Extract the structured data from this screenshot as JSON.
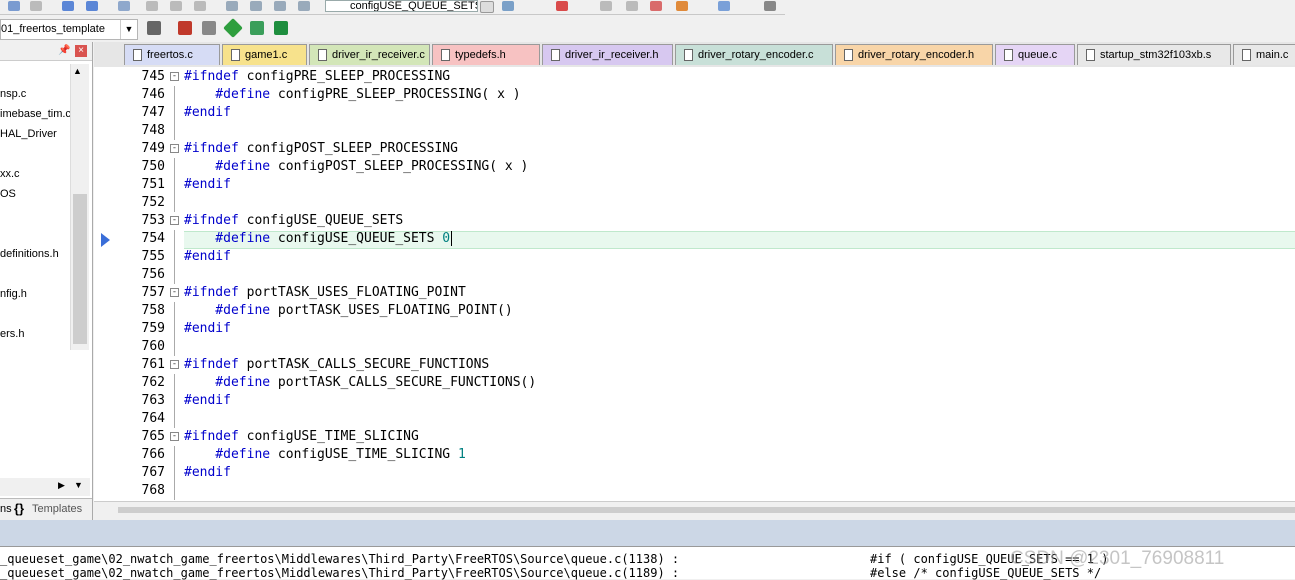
{
  "toolbar": {
    "target_combo": "configUSE_QUEUE_SETS",
    "project_combo": "01_freertos_template"
  },
  "project_tree": {
    "items": [
      "nsp.c",
      "imebase_tim.c",
      "HAL_Driver",
      "xx.c",
      "OS",
      "definitions.h",
      "nfig.h",
      "ers.h"
    ],
    "tabs": [
      "ns",
      "Templates"
    ]
  },
  "editor_tabs": [
    {
      "label": "freertos.c",
      "color": "#d6dcf5"
    },
    {
      "label": "game1.c",
      "color": "#f7e28c"
    },
    {
      "label": "driver_ir_receiver.c",
      "color": "#d3e6b8"
    },
    {
      "label": "typedefs.h",
      "color": "#f7c2c2"
    },
    {
      "label": "driver_ir_receiver.h",
      "color": "#d7c8f0"
    },
    {
      "label": "driver_rotary_encoder.c",
      "color": "#c8e0d8"
    },
    {
      "label": "driver_rotary_encoder.h",
      "color": "#f8d5a8"
    },
    {
      "label": "queue.c",
      "color": "#e5d5f5"
    },
    {
      "label": "startup_stm32f103xb.s",
      "color": "#e8e8e8"
    },
    {
      "label": "main.c",
      "color": "#e8e8e8"
    }
  ],
  "code_lines": [
    {
      "n": "745",
      "fold": "-",
      "directive": "#ifndef",
      "rest": " configPRE_SLEEP_PROCESSING",
      "value": ""
    },
    {
      "n": "746",
      "fold": "",
      "directive": "    #define",
      "rest": " configPRE_SLEEP_PROCESSING( x )",
      "value": ""
    },
    {
      "n": "747",
      "fold": "",
      "directive": "#endif",
      "rest": "",
      "value": ""
    },
    {
      "n": "748",
      "fold": "",
      "directive": "",
      "rest": "",
      "value": ""
    },
    {
      "n": "749",
      "fold": "-",
      "directive": "#ifndef",
      "rest": " configPOST_SLEEP_PROCESSING",
      "value": ""
    },
    {
      "n": "750",
      "fold": "",
      "directive": "    #define",
      "rest": " configPOST_SLEEP_PROCESSING( x )",
      "value": ""
    },
    {
      "n": "751",
      "fold": "",
      "directive": "#endif",
      "rest": "",
      "value": ""
    },
    {
      "n": "752",
      "fold": "",
      "directive": "",
      "rest": "",
      "value": ""
    },
    {
      "n": "753",
      "fold": "-",
      "directive": "#ifndef",
      "rest": " configUSE_QUEUE_SETS",
      "value": ""
    },
    {
      "n": "754",
      "fold": "",
      "directive": "    #define",
      "rest": " configUSE_QUEUE_SETS ",
      "value": "0"
    },
    {
      "n": "755",
      "fold": "",
      "directive": "#endif",
      "rest": "",
      "value": ""
    },
    {
      "n": "756",
      "fold": "",
      "directive": "",
      "rest": "",
      "value": ""
    },
    {
      "n": "757",
      "fold": "-",
      "directive": "#ifndef",
      "rest": " portTASK_USES_FLOATING_POINT",
      "value": ""
    },
    {
      "n": "758",
      "fold": "",
      "directive": "    #define",
      "rest": " portTASK_USES_FLOATING_POINT()",
      "value": ""
    },
    {
      "n": "759",
      "fold": "",
      "directive": "#endif",
      "rest": "",
      "value": ""
    },
    {
      "n": "760",
      "fold": "",
      "directive": "",
      "rest": "",
      "value": ""
    },
    {
      "n": "761",
      "fold": "-",
      "directive": "#ifndef",
      "rest": " portTASK_CALLS_SECURE_FUNCTIONS",
      "value": ""
    },
    {
      "n": "762",
      "fold": "",
      "directive": "    #define",
      "rest": " portTASK_CALLS_SECURE_FUNCTIONS()",
      "value": ""
    },
    {
      "n": "763",
      "fold": "",
      "directive": "#endif",
      "rest": "",
      "value": ""
    },
    {
      "n": "764",
      "fold": "",
      "directive": "",
      "rest": "",
      "value": ""
    },
    {
      "n": "765",
      "fold": "-",
      "directive": "#ifndef",
      "rest": " configUSE_TIME_SLICING",
      "value": ""
    },
    {
      "n": "766",
      "fold": "",
      "directive": "    #define",
      "rest": " configUSE_TIME_SLICING ",
      "value": "1"
    },
    {
      "n": "767",
      "fold": "",
      "directive": "#endif",
      "rest": "",
      "value": ""
    },
    {
      "n": "768",
      "fold": "",
      "directive": "",
      "rest": "",
      "value": ""
    }
  ],
  "build_output": {
    "lines": [
      {
        "left": "_queueset_game\\02_nwatch_game_freertos\\Middlewares\\Third_Party\\FreeRTOS\\Source\\queue.c(1138) :",
        "right": "#if ( configUSE_QUEUE_SETS == 1 )"
      },
      {
        "left": "_queueset_game\\02_nwatch_game_freertos\\Middlewares\\Third_Party\\FreeRTOS\\Source\\queue.c(1189) :",
        "right": "#else /* configUSE_QUEUE_SETS */"
      }
    ],
    "watermark": "CSDN @2301_76908811"
  }
}
